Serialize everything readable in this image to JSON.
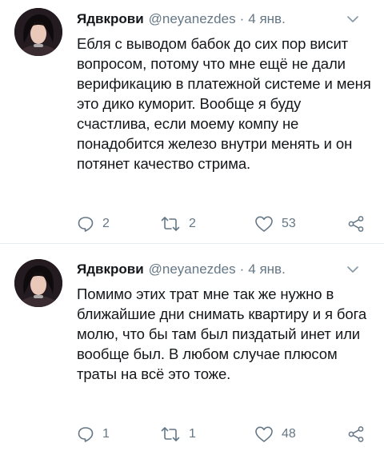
{
  "tweets": [
    {
      "author_name": "Ядвкрови",
      "handle": "@neyanezdes",
      "separator": "·",
      "date": "4 янв.",
      "text": "Ебля с выводом бабок до сих пор висит вопросом, потому что мне ещё не дали верификацию в платежной системе и меня это дико куморит. Вообще я буду счастлива, если моему компу не понадобится железо внутри менять и он потянет качество стрима.",
      "replies": "2",
      "retweets": "2",
      "likes": "53"
    },
    {
      "author_name": "Ядвкрови",
      "handle": "@neyanezdes",
      "separator": "·",
      "date": "4 янв.",
      "text": "Помимо этих трат мне так же нужно в ближайшие дни снимать квартиру и я бога молю, что бы там был пиздатый инет или вообще был. В любом случае плюсом траты на всё это тоже.",
      "replies": "1",
      "retweets": "1",
      "likes": "48"
    }
  ],
  "icons": {
    "reply": "reply-icon",
    "retweet": "retweet-icon",
    "like": "heart-icon",
    "share": "share-icon",
    "menu": "chevron-down-icon"
  },
  "colors": {
    "text": "#14171a",
    "secondary": "#657786",
    "divider": "#e6ecf0"
  }
}
